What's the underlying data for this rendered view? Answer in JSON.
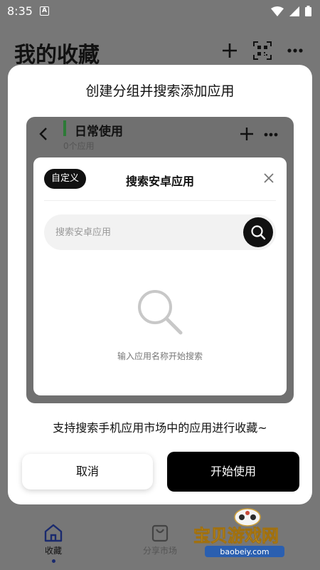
{
  "status_bar": {
    "time": "8:35",
    "notification_letter": "A"
  },
  "background": {
    "title": "我的收藏",
    "icons": [
      "plus-icon",
      "qr-scan-icon",
      "more-icon"
    ]
  },
  "modal": {
    "title": "创建分组并搜索添加应用",
    "preview": {
      "group_name": "日常使用",
      "app_count": "0个应用",
      "accent_color": "#2d7a37"
    },
    "search_card": {
      "tag": "自定义",
      "title": "搜索安卓应用",
      "search_placeholder": "搜索安卓应用",
      "empty_hint": "输入应用名称开始搜索"
    },
    "description": "支持搜索手机应用市场中的应用进行收藏~",
    "cancel_label": "取消",
    "start_label": "开始使用"
  },
  "bottom_nav": [
    {
      "label": "收藏",
      "icon": "home-icon",
      "active": true
    },
    {
      "label": "分享市场",
      "icon": "shopping-bag-icon",
      "active": false
    }
  ],
  "watermark": {
    "title": "宝贝游戏网",
    "url": "baobeiy.com"
  },
  "colors": {
    "overlay": "#777777",
    "primary": "#000000",
    "accent_green": "#2d7a37"
  }
}
